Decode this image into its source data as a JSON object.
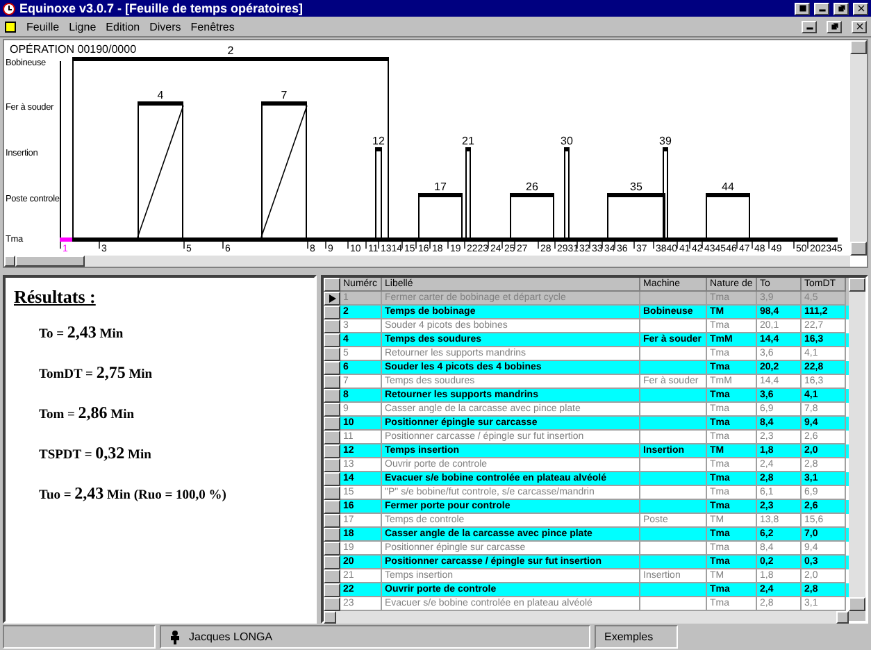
{
  "window": {
    "title": "Equinoxe v3.0.7 - [Feuille de temps opératoires]"
  },
  "menu": [
    {
      "label": "Feuille"
    },
    {
      "label": "Ligne"
    },
    {
      "label": "Edition"
    },
    {
      "label": "Divers"
    },
    {
      "label": "Fenêtres"
    }
  ],
  "diagram": {
    "operation": "OPÉRATION 00190/0000",
    "lanes": [
      {
        "name": "Bobineuse",
        "bars": [
          {
            "label": "2"
          }
        ]
      },
      {
        "name": "Fer à souder",
        "bars": [
          {
            "label": "4"
          },
          {
            "label": "7"
          }
        ]
      },
      {
        "name": "Insertion",
        "bars": [
          {
            "label": "12"
          },
          {
            "label": "21"
          },
          {
            "label": "30"
          },
          {
            "label": "39"
          }
        ]
      },
      {
        "name": "Poste controle",
        "bars": [
          {
            "label": "17"
          },
          {
            "label": "26"
          },
          {
            "label": "35"
          },
          {
            "label": "44"
          }
        ]
      },
      {
        "name": "Tma"
      }
    ],
    "axis_labels": [
      "1",
      "3",
      "5",
      "6",
      "8",
      "9",
      "10",
      "11",
      "1314",
      "15",
      "16",
      "18",
      "19",
      "2223",
      "24",
      "25",
      "27",
      "28",
      "2931",
      "32",
      "33",
      "34",
      "36",
      "37",
      "3840",
      "41",
      "42",
      "434546",
      "47",
      "48",
      "49",
      "50",
      "202345"
    ]
  },
  "results": {
    "title": "Résultats :",
    "lines": [
      {
        "label": "To =",
        "value": "2,43",
        "unit": "Min"
      },
      {
        "label": "TomDT =",
        "value": "2,75",
        "unit": "Min"
      },
      {
        "label": "Tom =",
        "value": "2,86",
        "unit": "Min"
      },
      {
        "label": "TSPDT =",
        "value": "0,32",
        "unit": "Min"
      },
      {
        "label": "Tuo =",
        "value": "2,43",
        "unit": "Min",
        "note": "(Ruo = 100,0 %)"
      }
    ]
  },
  "table": {
    "columns": [
      "Numérc",
      "Libellé",
      "Machine",
      "Nature de",
      "To",
      "TomDT"
    ],
    "rows": [
      {
        "cells": [
          "1",
          "Fermer carter de bobinage et départ cycle",
          "",
          "Tma",
          "3,9",
          "4,5"
        ],
        "highlighted": false,
        "selected": true
      },
      {
        "cells": [
          "2",
          "Temps de bobinage",
          "Bobineuse",
          "TM",
          "98,4",
          "111,2"
        ],
        "highlighted": true,
        "selected": false
      },
      {
        "cells": [
          "3",
          "Souder 4 picots des bobines",
          "",
          "Tma",
          "20,1",
          "22,7"
        ],
        "highlighted": false,
        "selected": false
      },
      {
        "cells": [
          "4",
          "Temps des soudures",
          "Fer à souder",
          "TmM",
          "14,4",
          "16,3"
        ],
        "highlighted": true,
        "selected": false
      },
      {
        "cells": [
          "5",
          "Retourner les supports mandrins",
          "",
          "Tma",
          "3,6",
          "4,1"
        ],
        "highlighted": false,
        "selected": false
      },
      {
        "cells": [
          "6",
          "Souder les 4 picots des 4 bobines",
          "",
          "Tma",
          "20,2",
          "22,8"
        ],
        "highlighted": true,
        "selected": false
      },
      {
        "cells": [
          "7",
          "Temps des soudures",
          "Fer à souder",
          "TmM",
          "14,4",
          "16,3"
        ],
        "highlighted": false,
        "selected": false
      },
      {
        "cells": [
          "8",
          "Retourner les supports mandrins",
          "",
          "Tma",
          "3,6",
          "4,1"
        ],
        "highlighted": true,
        "selected": false
      },
      {
        "cells": [
          "9",
          "Casser angle de la carcasse avec pince plate",
          "",
          "Tma",
          "6,9",
          "7,8"
        ],
        "highlighted": false,
        "selected": false
      },
      {
        "cells": [
          "10",
          "Positionner épingle sur carcasse",
          "",
          "Tma",
          "8,4",
          "9,4"
        ],
        "highlighted": true,
        "selected": false
      },
      {
        "cells": [
          "11",
          "Positionner carcasse / épingle sur fut insertion",
          "",
          "Tma",
          "2,3",
          "2,6"
        ],
        "highlighted": false,
        "selected": false
      },
      {
        "cells": [
          "12",
          "Temps insertion",
          "Insertion",
          "TM",
          "1,8",
          "2,0"
        ],
        "highlighted": true,
        "selected": false
      },
      {
        "cells": [
          "13",
          "Ouvrir porte de controle",
          "",
          "Tma",
          "2,4",
          "2,8"
        ],
        "highlighted": false,
        "selected": false
      },
      {
        "cells": [
          "14",
          "Evacuer s/e bobine controlée en plateau alvéolé",
          "",
          "Tma",
          "2,8",
          "3,1"
        ],
        "highlighted": true,
        "selected": false
      },
      {
        "cells": [
          "15",
          "\"P\" s/e bobine/fut controle, s/e carcasse/mandrin",
          "",
          "Tma",
          "6,1",
          "6,9"
        ],
        "highlighted": false,
        "selected": false
      },
      {
        "cells": [
          "16",
          "Fermer porte pour controle",
          "",
          "Tma",
          "2,3",
          "2,6"
        ],
        "highlighted": true,
        "selected": false
      },
      {
        "cells": [
          "17",
          "Temps de controle",
          "Poste",
          "TM",
          "13,8",
          "15,6"
        ],
        "highlighted": false,
        "selected": false
      },
      {
        "cells": [
          "18",
          "Casser angle de la carcasse avec pince plate",
          "",
          "Tma",
          "6,2",
          "7,0"
        ],
        "highlighted": true,
        "selected": false
      },
      {
        "cells": [
          "19",
          "Positionner épingle sur carcasse",
          "",
          "Tma",
          "8,4",
          "9,4"
        ],
        "highlighted": false,
        "selected": false
      },
      {
        "cells": [
          "20",
          "Positionner carcasse / épingle sur fut insertion",
          "",
          "Tma",
          "0,2",
          "0,3"
        ],
        "highlighted": true,
        "selected": false
      },
      {
        "cells": [
          "21",
          "Temps insertion",
          "Insertion",
          "TM",
          "1,8",
          "2,0"
        ],
        "highlighted": false,
        "selected": false
      },
      {
        "cells": [
          "22",
          "Ouvrir porte de controle",
          "",
          "Tma",
          "2,4",
          "2,8"
        ],
        "highlighted": true,
        "selected": false
      },
      {
        "cells": [
          "23",
          "Evacuer s/e bobine controlée en plateau alvéolé",
          "",
          "Tma",
          "2,8",
          "3,1"
        ],
        "highlighted": false,
        "selected": false
      }
    ]
  },
  "status_bar": {
    "user": "Jacques LONGA",
    "section": "Exemples"
  }
}
